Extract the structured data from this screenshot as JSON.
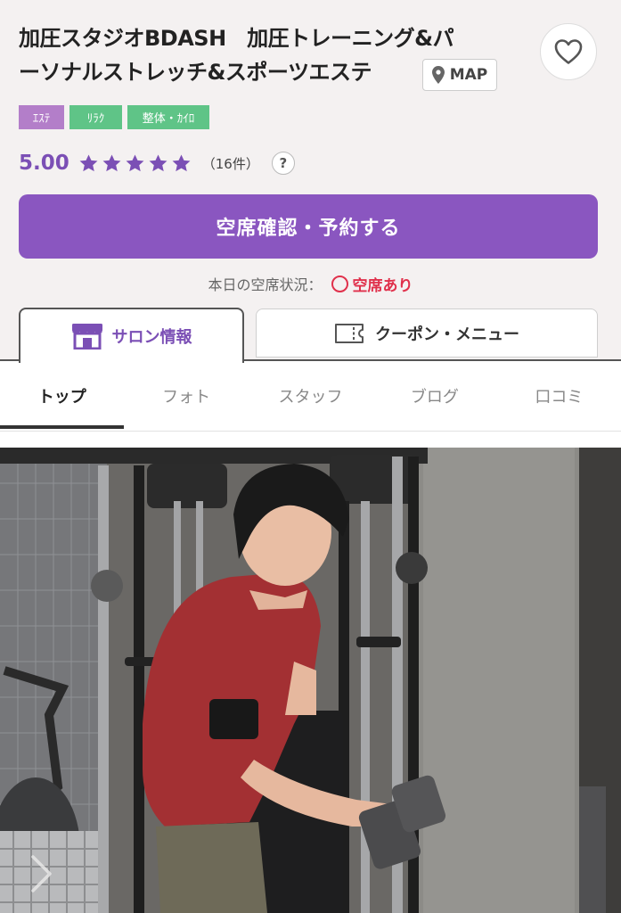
{
  "salon": {
    "title_line1": "加圧スタジオBDASH　加圧トレーニング&パ",
    "title_line2": "ーソナルストレッチ&スポーツエステ",
    "map_label": "MAP"
  },
  "tags": [
    "ｴｽﾃ",
    "ﾘﾗｸ",
    "整体・ｶｲﾛ"
  ],
  "rating": {
    "score": "5.00",
    "stars": 5,
    "count": "（16件）",
    "help": "?"
  },
  "reserve_button": "空席確認・予約する",
  "availability": {
    "label": "本日の空席状況：",
    "status": "空席あり"
  },
  "main_tabs": {
    "salon": "サロン情報",
    "coupon": "クーポン・メニュー"
  },
  "sub_tabs": [
    "トップ",
    "フォト",
    "スタッフ",
    "ブログ",
    "口コミ"
  ],
  "colors": {
    "brand_purple": "#8a56c0",
    "star_purple": "#7b4fb5",
    "available_red": "#e0304b",
    "tag_purple": "#b37ec9",
    "tag_green": "#5fc487"
  },
  "icons": {
    "favorite": "heart-icon",
    "map": "map-pin-icon",
    "salon_tab": "storefront-icon",
    "coupon_tab": "coupon-ticket-icon",
    "carousel_next": "chevron-right-icon"
  }
}
